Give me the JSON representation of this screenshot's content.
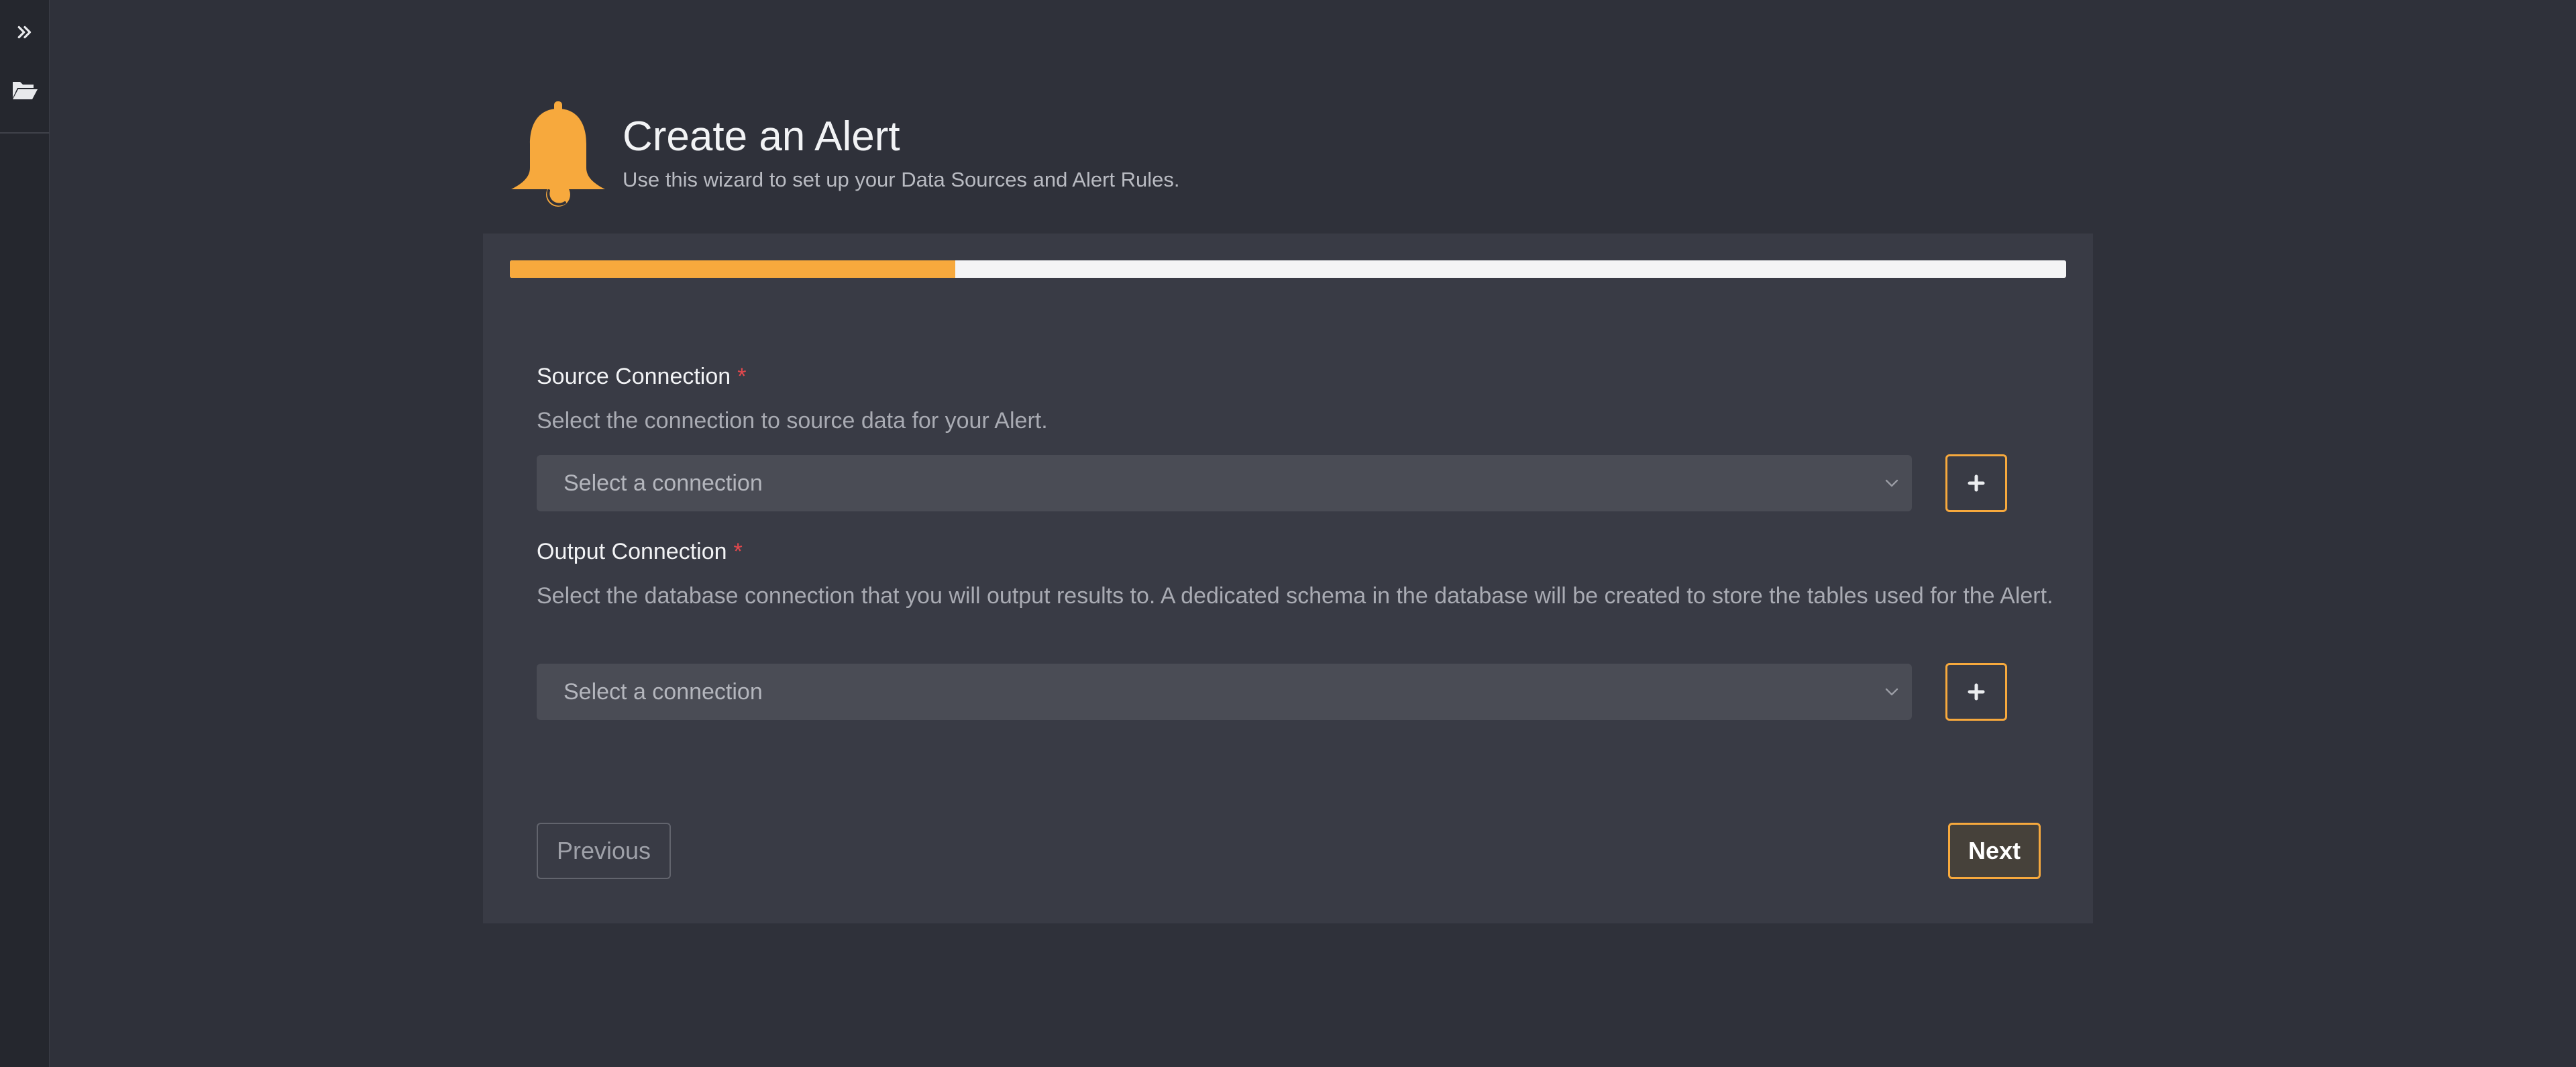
{
  "header": {
    "title": "Create an Alert",
    "subtitle": "Use this wizard to set up your Data Sources and Alert Rules."
  },
  "progress": {
    "fraction": 0.286
  },
  "source_connection": {
    "label": "Source Connection",
    "required_marker": "*",
    "help": "Select the connection to source data for your Alert.",
    "placeholder": "Select a connection"
  },
  "output_connection": {
    "label": "Output Connection",
    "required_marker": "*",
    "help": "Select the database connection that you will output results to. A dedicated schema in the database will be created to store the tables used for the Alert.",
    "placeholder": "Select a connection"
  },
  "footer": {
    "previous_label": "Previous",
    "next_label": "Next"
  },
  "icons": {
    "rail_expand": "double-chevron-right-icon",
    "rail_folder": "folder-open-icon",
    "header": "bell-icon",
    "select": "chevron-down-icon",
    "add": "plus-icon"
  },
  "colors": {
    "accent": "#f7a93d",
    "required": "#e5484d",
    "background": "#2f313a",
    "card": "#393b45"
  }
}
